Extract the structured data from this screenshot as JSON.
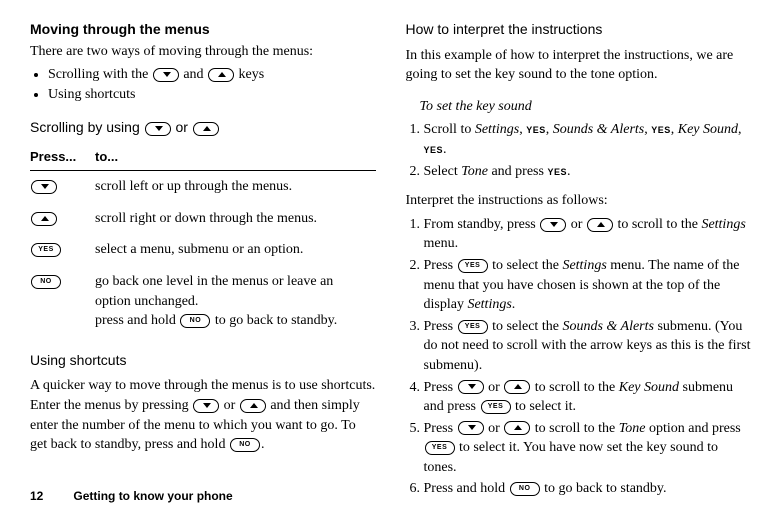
{
  "left": {
    "heading": "Moving through the menus",
    "intro": "There are two ways of moving through the menus:",
    "bullets": [
      "Scrolling with the ",
      " and ",
      " keys",
      "Using shortcuts"
    ],
    "scrollHead_a": "Scrolling by using ",
    "scrollHead_b": " or ",
    "table": {
      "h1": "Press...",
      "h2": "to...",
      "r1": "scroll left or up through the menus.",
      "r2": "scroll right or down through the menus.",
      "r3": "select a menu, submenu or an option.",
      "r4a": "go back one level in the menus or leave an option unchanged.",
      "r4b_a": "press and hold ",
      "r4b_b": " to go back to standby."
    },
    "shortHead": "Using shortcuts",
    "shortBody_a": "A quicker way to move through the menus is to use shortcuts. Enter the menus by pressing ",
    "shortBody_b": " or ",
    "shortBody_c": " and then simply enter the number of the menu to which you want to go. To get back to standby, press and hold ",
    "shortBody_d": "."
  },
  "right": {
    "heading": "How to interpret the instructions",
    "intro": "In this example of how to interpret the instructions, we are going to set the key sound to the tone option.",
    "procHead": "To set the key sound",
    "step1_a": "Scroll to ",
    "step1_settings": "Settings",
    "step1_c": ", ",
    "step1_yes": "YES",
    "step1_d": ", ",
    "step1_sa": "Sounds & Alerts",
    "step1_e": ", ",
    "step1_f": ", ",
    "step1_ks": "Key Sound",
    "step1_g": ", ",
    "step1_h": ".",
    "step2_a": "Select ",
    "step2_tone": "Tone",
    "step2_b": " and press ",
    "step2_c": ".",
    "interpLead": "Interpret the instructions as follows:",
    "i1_a": "From standby, press ",
    "i1_b": " or ",
    "i1_c": " to scroll to the ",
    "i1_settings": "Settings",
    "i1_d": " menu.",
    "i2_a": "Press ",
    "i2_b": " to select the ",
    "i2_settings": "Settings",
    "i2_c": " menu. The name of the menu that you have chosen is shown at the top of the display ",
    "i2_d": ".",
    "i3_a": "Press ",
    "i3_b": " to select the ",
    "i3_sa": "Sounds & Alerts",
    "i3_c": " submenu. (You do not need to scroll with the arrow keys as this is the first submenu).",
    "i4_a": "Press ",
    "i4_b": " or ",
    "i4_c": " to scroll to the ",
    "i4_ks": "Key Sound",
    "i4_d": " submenu and press ",
    "i4_e": " to select it.",
    "i5_a": "Press ",
    "i5_b": " or ",
    "i5_c": " to scroll to the ",
    "i5_tone": "Tone",
    "i5_d": " option and press ",
    "i5_e": " to select it. You have now set the key sound to tones.",
    "i6_a": "Press and hold ",
    "i6_b": " to go back to standby."
  },
  "footer": {
    "page": "12",
    "chapter": "Getting to know your phone"
  },
  "keys": {
    "yes": "YES",
    "no": "NO"
  }
}
